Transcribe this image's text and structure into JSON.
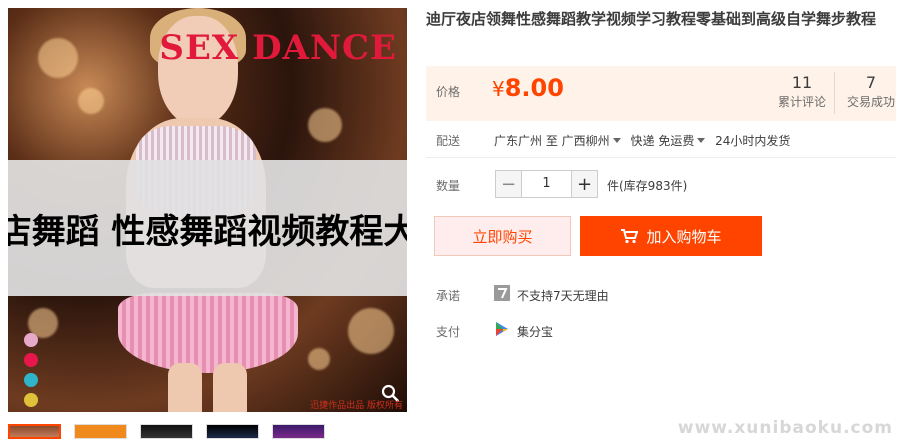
{
  "gallery": {
    "brand_text": "SEX DANCE",
    "banner_text": "夜店舞蹈 性感舞蹈视频教程大全",
    "small_watermark": "迅捷作品出品 版权所有",
    "dot_colors": [
      "#e7a9c9",
      "#e8174b",
      "#2fb5c9",
      "#e0c23a"
    ],
    "zoom_icon": "magnifier-icon",
    "thumbnail_count": 5
  },
  "product": {
    "title": "迪厅夜店领舞性感舞蹈教学视频学习教程零基础到高级自学舞步教程",
    "price_label": "价格",
    "currency": "¥",
    "price": "8.00",
    "reviews_count": "11",
    "reviews_label": "累计评论",
    "deals_count": "7",
    "deals_label": "交易成功",
    "delivery_label": "配送",
    "ship_from": "广东广州 至",
    "ship_to": "广西柳州",
    "shipping_method": "快递 免运费",
    "ship_time": "24小时内发货",
    "quantity_label": "数量",
    "quantity_value": "1",
    "stock_text": "件(库存983件)",
    "buy_now_label": "立即购买",
    "add_cart_label": "加入购物车",
    "promise_label": "承诺",
    "promise_text": "不支持7天无理由",
    "payment_label": "支付",
    "payment_text": "集分宝"
  },
  "colors": {
    "accent": "#ff4400",
    "price_bg": "#fff2e8"
  },
  "site_watermark": "www.xunibaoku.com"
}
